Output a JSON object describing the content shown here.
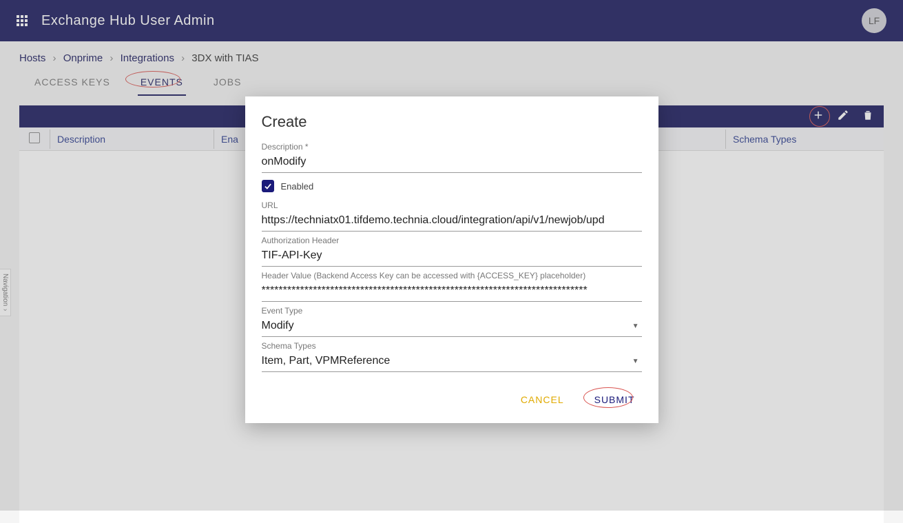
{
  "topbar": {
    "title": "Exchange Hub User Admin",
    "avatar": "LF"
  },
  "breadcrumb": {
    "items": [
      "Hosts",
      "Onprime",
      "Integrations",
      "3DX with TIAS"
    ]
  },
  "tabs": {
    "access_keys": "ACCESS KEYS",
    "events": "EVENTS",
    "jobs": "JOBS"
  },
  "table": {
    "headers": {
      "description": "Description",
      "enabled": "Ena",
      "schema": "Schema Types"
    }
  },
  "sideNav": {
    "label": "Navigation"
  },
  "modal": {
    "title": "Create",
    "description_label": "Description *",
    "description_value": "onModify",
    "enabled_label": "Enabled",
    "enabled_checked": true,
    "url_label": "URL",
    "url_value": "https://techniatx01.tifdemo.technia.cloud/integration/api/v1/newjob/upd",
    "auth_label": "Authorization Header",
    "auth_value": "TIF-API-Key",
    "header_value_label": "Header Value (Backend Access Key can be accessed with {ACCESS_KEY} placeholder)",
    "header_value_value": "****************************************************************************",
    "event_type_label": "Event Type",
    "event_type_value": "Modify",
    "schema_types_label": "Schema Types",
    "schema_types_value": "Item, Part, VPMReference",
    "cancel": "CANCEL",
    "submit": "SUBMIT"
  }
}
